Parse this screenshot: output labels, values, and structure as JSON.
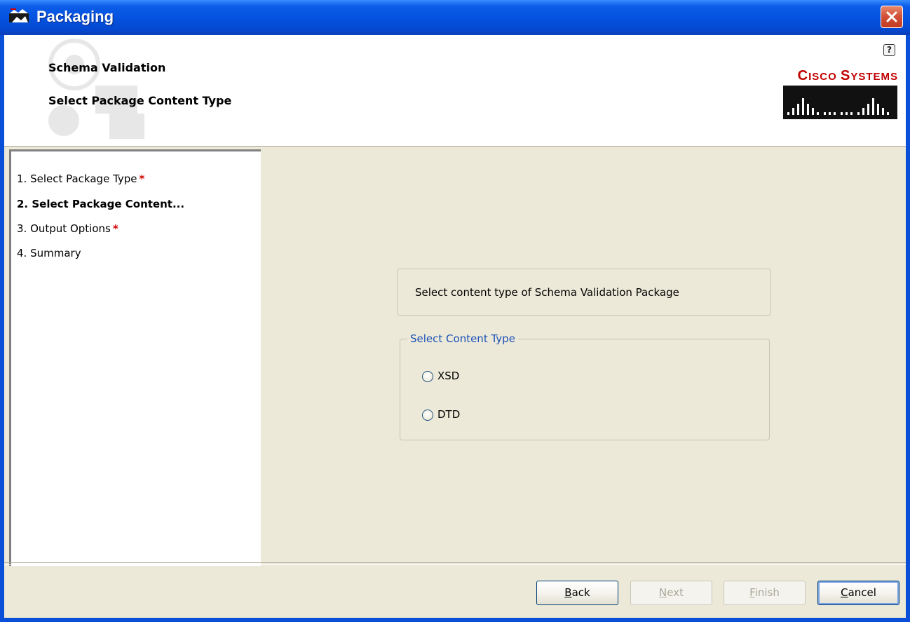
{
  "window": {
    "title": "Packaging",
    "icon": "packaging-app-icon",
    "close_icon": "close-icon"
  },
  "header": {
    "title": "Schema Validation",
    "subtitle": "Select Package Content Type",
    "help_glyph": "?",
    "logo": {
      "text_big": "C",
      "text_small": "ISCO ",
      "text_big2": "S",
      "text_small2": "YSTEMS",
      "full": "Cisco Systems"
    }
  },
  "steps": [
    {
      "label": "1. Select Package Type",
      "required": true,
      "active": false
    },
    {
      "label": "2. Select Package Content...",
      "required": false,
      "active": true
    },
    {
      "label": "3. Output Options",
      "required": true,
      "active": false
    },
    {
      "label": "4. Summary",
      "required": false,
      "active": false
    }
  ],
  "required_marker": "*",
  "main": {
    "info_text": "Select content type of Schema Validation Package",
    "group_title": "Select Content Type",
    "options": [
      {
        "label": "XSD",
        "selected": false
      },
      {
        "label": "DTD",
        "selected": false
      }
    ]
  },
  "buttons": {
    "back": {
      "pre": "",
      "mnemonic": "B",
      "post": "ack"
    },
    "next": {
      "pre": "",
      "mnemonic": "N",
      "post": "ext"
    },
    "finish": {
      "pre": "",
      "mnemonic": "F",
      "post": "inish"
    },
    "cancel": {
      "pre": "",
      "mnemonic": "C",
      "post": "ancel"
    }
  },
  "colors": {
    "titlebar": "#0553e0",
    "panel": "#ece9d8",
    "cisco_red": "#c00000",
    "required_red": "#d40000",
    "group_title_blue": "#1a50b8"
  }
}
